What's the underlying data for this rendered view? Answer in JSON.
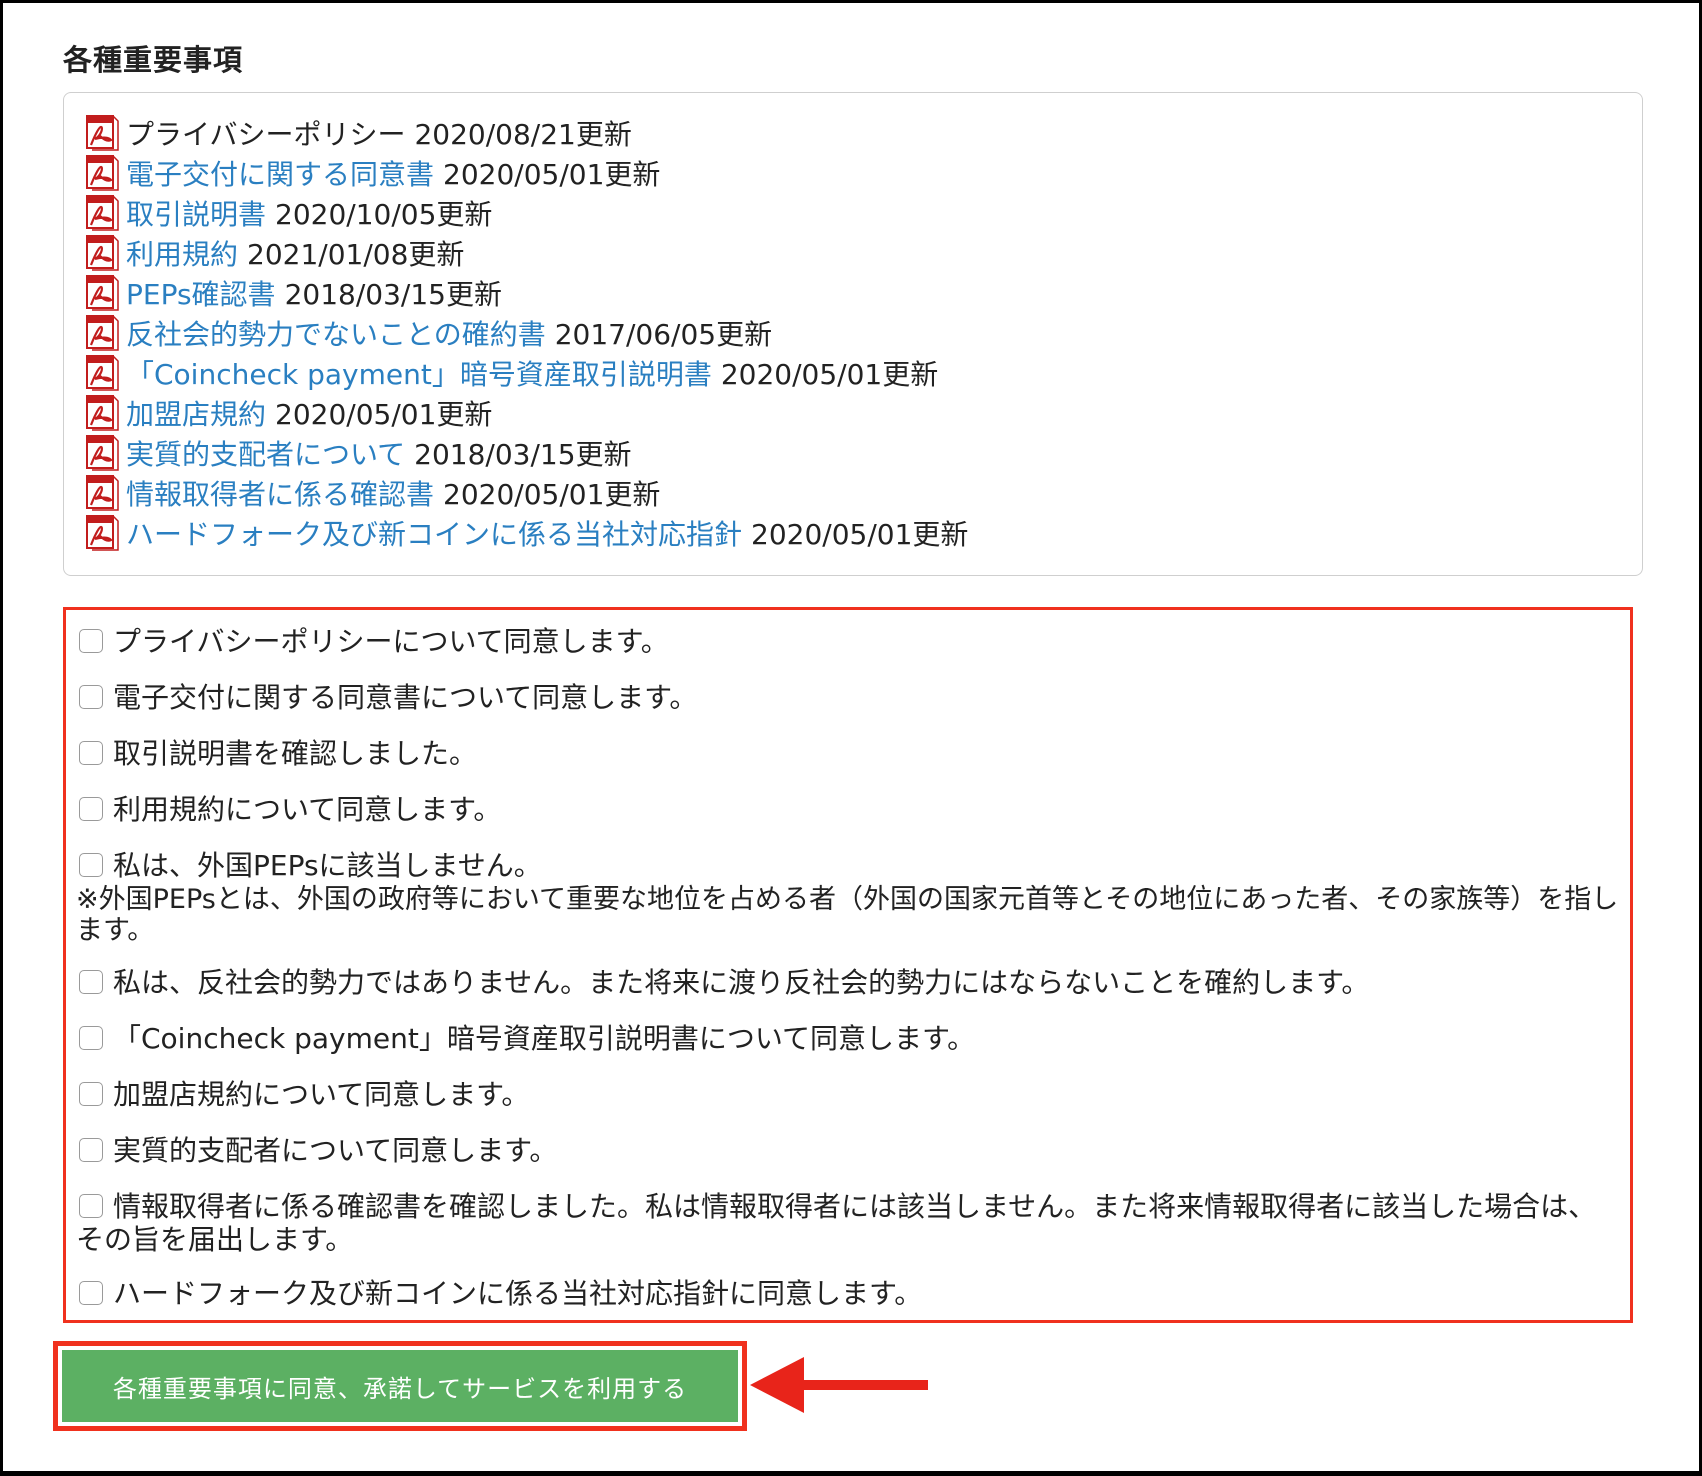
{
  "section_title": "各種重要事項",
  "colors": {
    "link": "#2a7fc1",
    "highlight": "#f0311e",
    "button": "#5cb063",
    "pdf_icon": "#c21d1d"
  },
  "documents": [
    {
      "icon": "pdf-icon",
      "title": "プライバシーポリシー",
      "date": "2020/08/21更新",
      "is_link": false
    },
    {
      "icon": "pdf-icon",
      "title": "電子交付に関する同意書",
      "date": "2020/05/01更新",
      "is_link": true
    },
    {
      "icon": "pdf-icon",
      "title": "取引説明書",
      "date": "2020/10/05更新",
      "is_link": true
    },
    {
      "icon": "pdf-icon",
      "title": "利用規約",
      "date": "2021/01/08更新",
      "is_link": true
    },
    {
      "icon": "pdf-icon",
      "title": "PEPs確認書",
      "date": "2018/03/15更新",
      "is_link": true
    },
    {
      "icon": "pdf-icon",
      "title": "反社会的勢力でないことの確約書",
      "date": "2017/06/05更新",
      "is_link": true
    },
    {
      "icon": "pdf-icon",
      "title": "「Coincheck payment」暗号資産取引説明書",
      "date": "2020/05/01更新",
      "is_link": true
    },
    {
      "icon": "pdf-icon",
      "title": "加盟店規約",
      "date": "2020/05/01更新",
      "is_link": true
    },
    {
      "icon": "pdf-icon",
      "title": "実質的支配者について",
      "date": "2018/03/15更新",
      "is_link": true
    },
    {
      "icon": "pdf-icon",
      "title": "情報取得者に係る確認書",
      "date": "2020/05/01更新",
      "is_link": true
    },
    {
      "icon": "pdf-icon",
      "title": "ハードフォーク及び新コインに係る当社対応指針",
      "date": "2020/05/01更新",
      "is_link": true
    }
  ],
  "consents": [
    {
      "label": "プライバシーポリシーについて同意します。",
      "checked": false
    },
    {
      "label": "電子交付に関する同意書について同意します。",
      "checked": false
    },
    {
      "label": "取引説明書を確認しました。",
      "checked": false
    },
    {
      "label": "利用規約について同意します。",
      "checked": false
    },
    {
      "label": "私は、外国PEPsに該当しません。",
      "note": "※外国PEPsとは、外国の政府等において重要な地位を占める者（外国の国家元首等とその地位にあった者、その家族等）を指します。",
      "checked": false
    },
    {
      "label": "私は、反社会的勢力ではありません。また将来に渡り反社会的勢力にはならないことを確約します。",
      "checked": false
    },
    {
      "label": "「Coincheck payment」暗号資産取引説明書について同意します。",
      "checked": false
    },
    {
      "label": "加盟店規約について同意します。",
      "checked": false
    },
    {
      "label": "実質的支配者について同意します。",
      "checked": false
    },
    {
      "label": "情報取得者に係る確認書を確認しました。私は情報取得者には該当しません。また将来情報取得者に該当した場合は、その旨を届出します。",
      "checked": false
    },
    {
      "label": "ハードフォーク及び新コインに係る当社対応指針に同意します。",
      "checked": false
    }
  ],
  "submit_label": "各種重要事項に同意、承諾してサービスを利用する"
}
